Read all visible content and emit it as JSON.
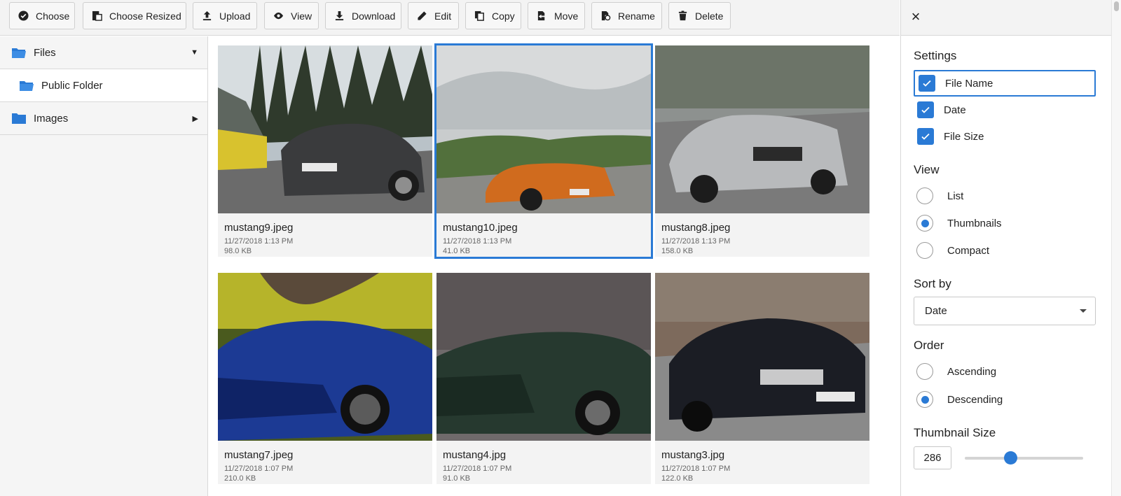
{
  "toolbar": {
    "buttons": [
      {
        "label": "Choose",
        "icon": "check-circle-icon"
      },
      {
        "label": "Choose Resized",
        "icon": "resize-icon"
      },
      {
        "label": "Upload",
        "icon": "upload-icon"
      },
      {
        "label": "View",
        "icon": "eye-icon"
      },
      {
        "label": "Download",
        "icon": "download-icon"
      },
      {
        "label": "Edit",
        "icon": "pencil-icon"
      },
      {
        "label": "Copy",
        "icon": "copy-icon"
      },
      {
        "label": "Move",
        "icon": "move-icon"
      },
      {
        "label": "Rename",
        "icon": "rename-icon"
      },
      {
        "label": "Delete",
        "icon": "trash-icon"
      }
    ]
  },
  "sidebar": {
    "items": [
      {
        "label": "Files",
        "icon": "folder-open-icon",
        "expanded": true
      },
      {
        "label": "Public Folder",
        "icon": "folder-open-icon"
      },
      {
        "label": "Images",
        "icon": "folder-icon",
        "expanded": false
      }
    ]
  },
  "files": [
    {
      "name": "mustang9.jpeg",
      "date": "11/27/2018 1:13 PM",
      "size": "98.0 KB",
      "selected": false
    },
    {
      "name": "mustang10.jpeg",
      "date": "11/27/2018 1:13 PM",
      "size": "41.0 KB",
      "selected": true
    },
    {
      "name": "mustang8.jpeg",
      "date": "11/27/2018 1:13 PM",
      "size": "158.0 KB",
      "selected": false
    },
    {
      "name": "mustang7.jpeg",
      "date": "11/27/2018 1:07 PM",
      "size": "210.0 KB",
      "selected": false
    },
    {
      "name": "mustang4.jpg",
      "date": "11/27/2018 1:07 PM",
      "size": "91.0 KB",
      "selected": false
    },
    {
      "name": "mustang3.jpg",
      "date": "11/27/2018 1:07 PM",
      "size": "122.0 KB",
      "selected": false
    }
  ],
  "settings": {
    "title": "Settings",
    "checkboxes": [
      {
        "label": "File Name",
        "checked": true
      },
      {
        "label": "Date",
        "checked": true
      },
      {
        "label": "File Size",
        "checked": true
      }
    ],
    "view": {
      "title": "View",
      "options": [
        {
          "label": "List",
          "selected": false
        },
        {
          "label": "Thumbnails",
          "selected": true
        },
        {
          "label": "Compact",
          "selected": false
        }
      ]
    },
    "sort": {
      "title": "Sort by",
      "value": "Date"
    },
    "order": {
      "title": "Order",
      "options": [
        {
          "label": "Ascending",
          "selected": false
        },
        {
          "label": "Descending",
          "selected": true
        }
      ]
    },
    "thumbnail_size": {
      "title": "Thumbnail Size",
      "value": "286",
      "slider_fraction": 0.39
    }
  },
  "colors": {
    "accent": "#2a7ad5",
    "toolbar_bg": "#f3f3f3",
    "card_bg": "#f3f3f3"
  }
}
